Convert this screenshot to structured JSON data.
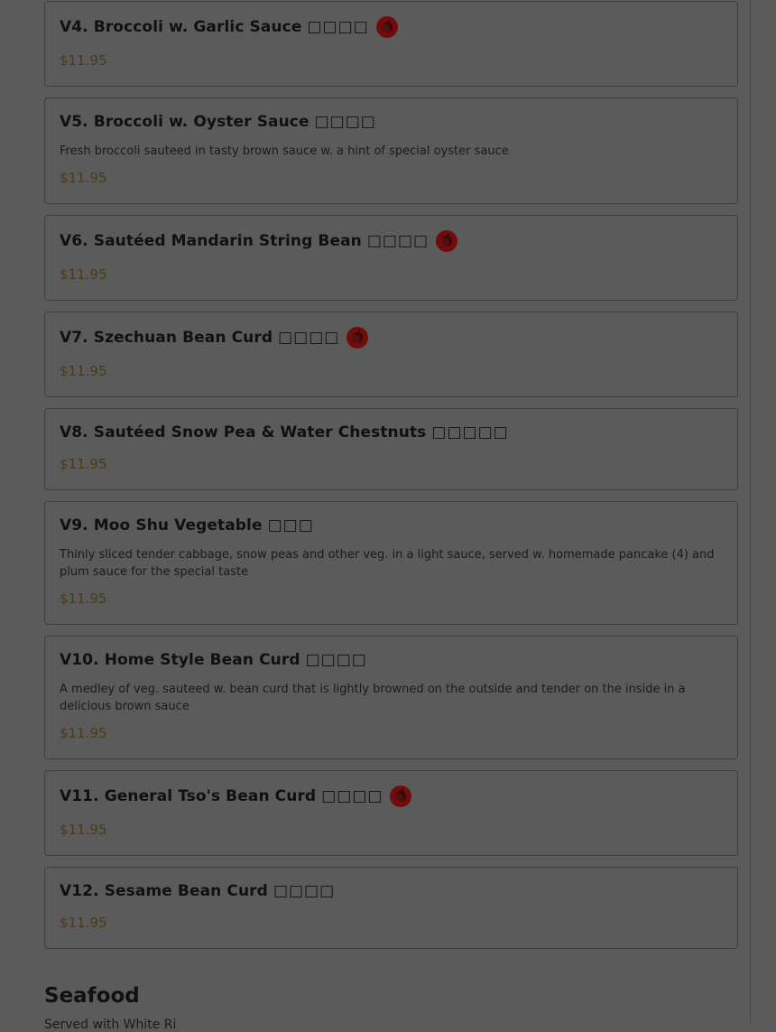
{
  "items": [
    {
      "title": "V4. Broccoli w. Garlic Sauce",
      "chinese": "□□□□",
      "spicy": true,
      "description": "",
      "price": "$11.95"
    },
    {
      "title": "V5. Broccoli w. Oyster Sauce",
      "chinese": "□□□□",
      "spicy": false,
      "description": "Fresh broccoli sauteed in tasty brown sauce w. a hint of special oyster sauce",
      "price": "$11.95"
    },
    {
      "title": "V6. Sautéed Mandarin String Bean",
      "chinese": "□□□□",
      "spicy": true,
      "description": "",
      "price": "$11.95"
    },
    {
      "title": "V7. Szechuan Bean Curd",
      "chinese": "□□□□",
      "spicy": true,
      "description": "",
      "price": "$11.95"
    },
    {
      "title": "V8. Sautéed Snow Pea & Water Chestnuts",
      "chinese": "□□□□□",
      "spicy": false,
      "description": "",
      "price": "$11.95"
    },
    {
      "title": "V9. Moo Shu Vegetable",
      "chinese": "□□□",
      "spicy": false,
      "description": "Thinly sliced tender cabbage, snow peas and other veg. in a light sauce, served w. homemade pancake (4) and plum sauce for the special taste",
      "price": "$11.95"
    },
    {
      "title": "V10. Home Style Bean Curd",
      "chinese": "□□□□",
      "spicy": false,
      "description": "A medley of veg. sauteed w. bean curd that is lightly browned on the outside and tender on the inside in a delicious brown sauce",
      "price": "$11.95"
    },
    {
      "title": "V11. General Tso's Bean Curd",
      "chinese": "□□□□",
      "spicy": true,
      "description": "",
      "price": "$11.95"
    },
    {
      "title": "V12. Sesame Bean Curd",
      "chinese": "□□□□",
      "spicy": false,
      "description": "",
      "price": "$11.95"
    }
  ],
  "section": {
    "title": "Seafood",
    "subtitle": "Served with White Ri"
  },
  "icons": {
    "spicy": "chili-pepper-icon"
  },
  "colors": {
    "price": "#4a3a18",
    "spicy_badge": "#6f0c0c",
    "overlay_bg": "#5b5b5b"
  }
}
